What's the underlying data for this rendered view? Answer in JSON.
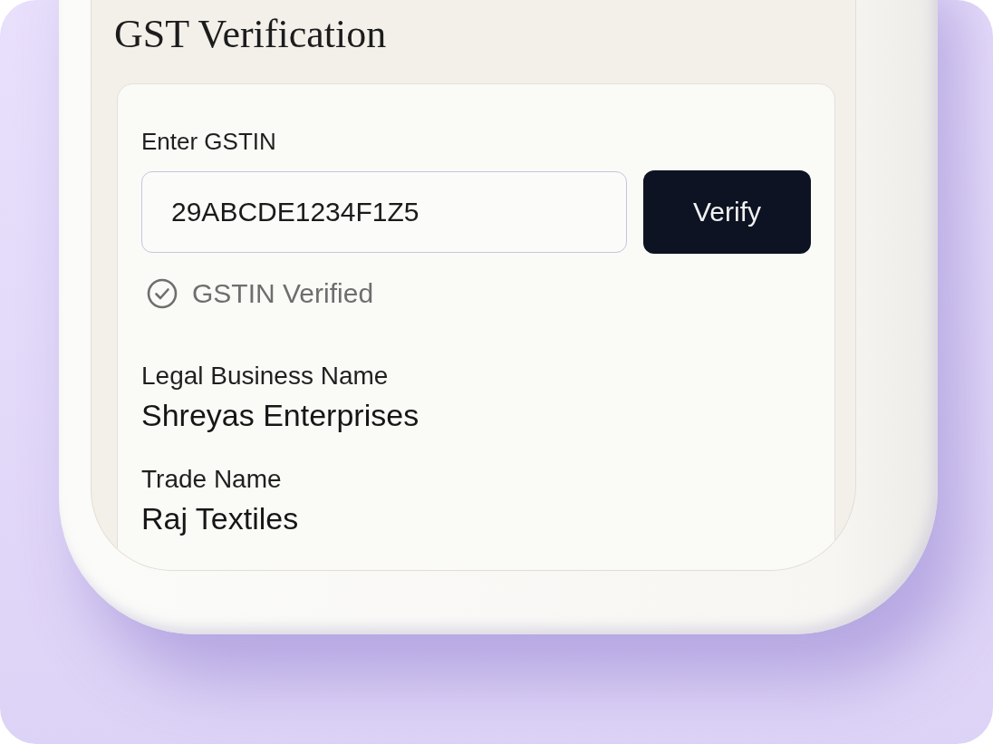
{
  "screen": {
    "title": "GST Verification"
  },
  "gstin_form": {
    "label": "Enter GSTIN",
    "value": "29ABCDE1234F1Z5",
    "button": "Verify",
    "status": {
      "verified": true,
      "text": "GSTIN Verified"
    }
  },
  "details": [
    {
      "label": "Legal Business Name",
      "value": "Shreyas Enterprises"
    },
    {
      "label": "Trade Name",
      "value": "Raj Textiles"
    }
  ]
}
